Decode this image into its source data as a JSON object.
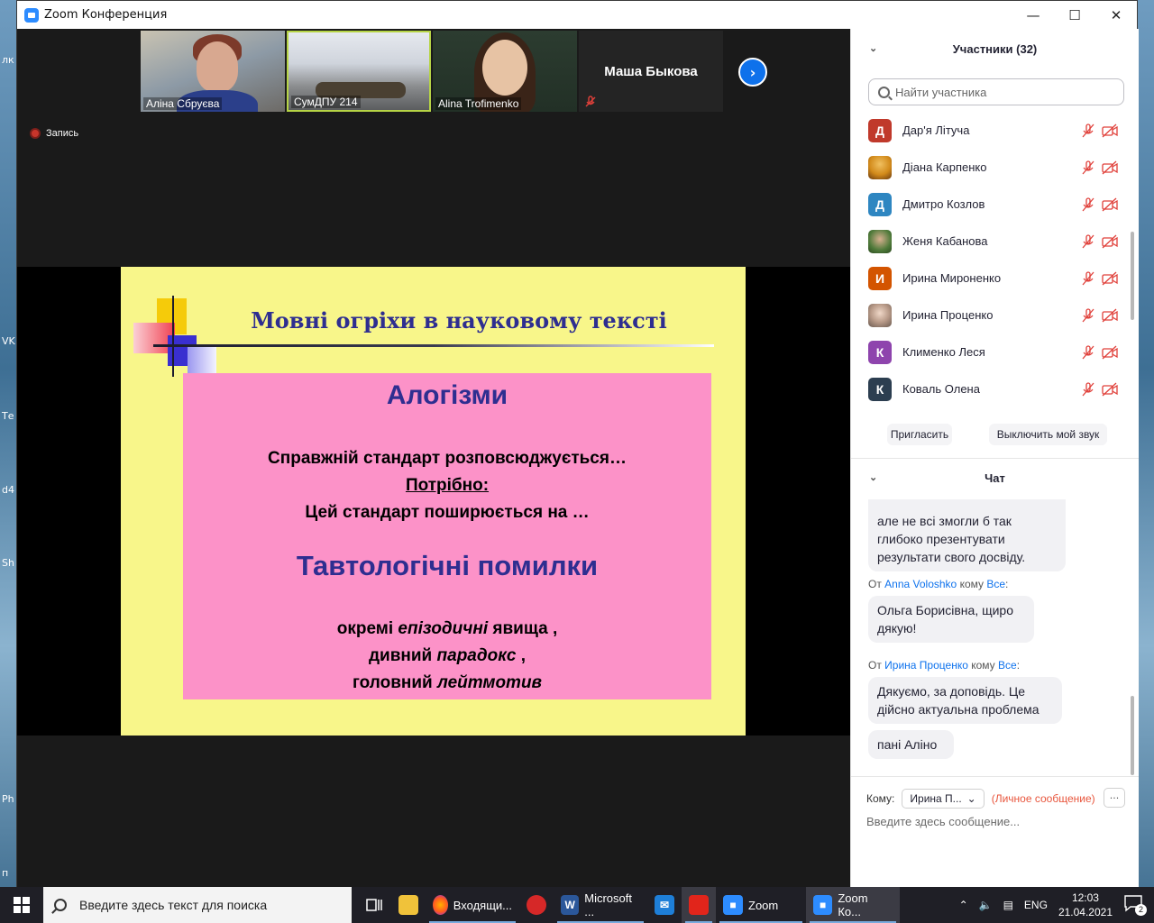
{
  "window": {
    "title": "Zoom Конференция",
    "minimize": "—",
    "maximize": "☐",
    "close": "✕"
  },
  "desktop_labels": [
    "лк",
    "VK",
    "Те",
    "d4",
    "Sh",
    "Ph",
    "п"
  ],
  "thumbnails": [
    {
      "label": "Аліна Сбруєва"
    },
    {
      "label": "СумДПУ 214"
    },
    {
      "label": "Alina Trofimenko"
    },
    {
      "big_name": "Маша Быкова"
    }
  ],
  "recording": {
    "label": "Запись"
  },
  "slide": {
    "title": "Мовні огріхи в науковому тексті",
    "heading1": "Алогізми",
    "line1": "Справжній стандарт розповсюджується…",
    "line2": "Потрібно:",
    "line3": "Цей стандарт поширюється на …",
    "heading2": "Тавтологічні помилки",
    "line4_a": "окремі ",
    "line4_b": "епізодичні",
    "line4_c": " явища ,",
    "line5_a": "дивний ",
    "line5_b": "парадокс",
    "line5_c": " ,",
    "line6_a": "головний ",
    "line6_b": "лейтмотив"
  },
  "participants": {
    "header": "Участники (32)",
    "search_placeholder": "Найти участника",
    "items": [
      {
        "initial": "Д",
        "name": "Дар'я Літуча",
        "color": "#c0392b",
        "photo": false
      },
      {
        "initial": "",
        "name": "Діана Карпенко",
        "color": "#d28a1a",
        "photo": true
      },
      {
        "initial": "Д",
        "name": "Дмитро Козлов",
        "color": "#2e86c1",
        "photo": false
      },
      {
        "initial": "",
        "name": "Женя Кабанова",
        "color": "#4f7a3a",
        "photo": true
      },
      {
        "initial": "И",
        "name": "Ирина Мироненко",
        "color": "#d35400",
        "photo": false
      },
      {
        "initial": "",
        "name": "Ирина Проценко",
        "color": "#8e7a6a",
        "photo": true
      },
      {
        "initial": "К",
        "name": "Клименко Леся",
        "color": "#8e44ad",
        "photo": false
      },
      {
        "initial": "К",
        "name": "Коваль Олена",
        "color": "#2c3e50",
        "photo": false
      }
    ],
    "invite_label": "Пригласить",
    "mute_me_label": "Выключить мой звук"
  },
  "chat": {
    "header": "Чат",
    "msg0": {
      "text_l1": "але не всі змогли б так",
      "text_l2": "глибоко презентувати",
      "text_l3": "результати свого досвіду."
    },
    "msg1": {
      "from_prefix": "От ",
      "from": "Anna Voloshko",
      "to_prefix": " кому ",
      "to": "Все",
      "suffix": ":",
      "text_l1": "Ольга Борисівна, щиро",
      "text_l2": "дякую!"
    },
    "msg2": {
      "from_prefix": "От ",
      "from": "Ирина Проценко",
      "to_prefix": " кому ",
      "to": "Все",
      "suffix": ":",
      "text_l1": "Дякуємо, за доповідь. Це",
      "text_l2": "дійсно актуальна проблема"
    },
    "msg3": {
      "text": "пані Аліно"
    },
    "to_label": "Кому:",
    "to_value": "Ирина П...",
    "private_label": "(Личное сообщение)",
    "more": "···",
    "input_placeholder": "Введите здесь сообщение..."
  },
  "taskbar": {
    "search_placeholder": "Введите здесь текст для поиска",
    "apps": [
      {
        "name": "firefox",
        "label": "Входящи..."
      },
      {
        "name": "word",
        "label": "Microsoft ..."
      },
      {
        "name": "zoom",
        "label": "Zoom"
      },
      {
        "name": "zoom-conf",
        "label": "Zoom Ко..."
      }
    ],
    "lang": "ENG",
    "time": "12:03",
    "date": "21.04.2021",
    "notifications": "2"
  }
}
